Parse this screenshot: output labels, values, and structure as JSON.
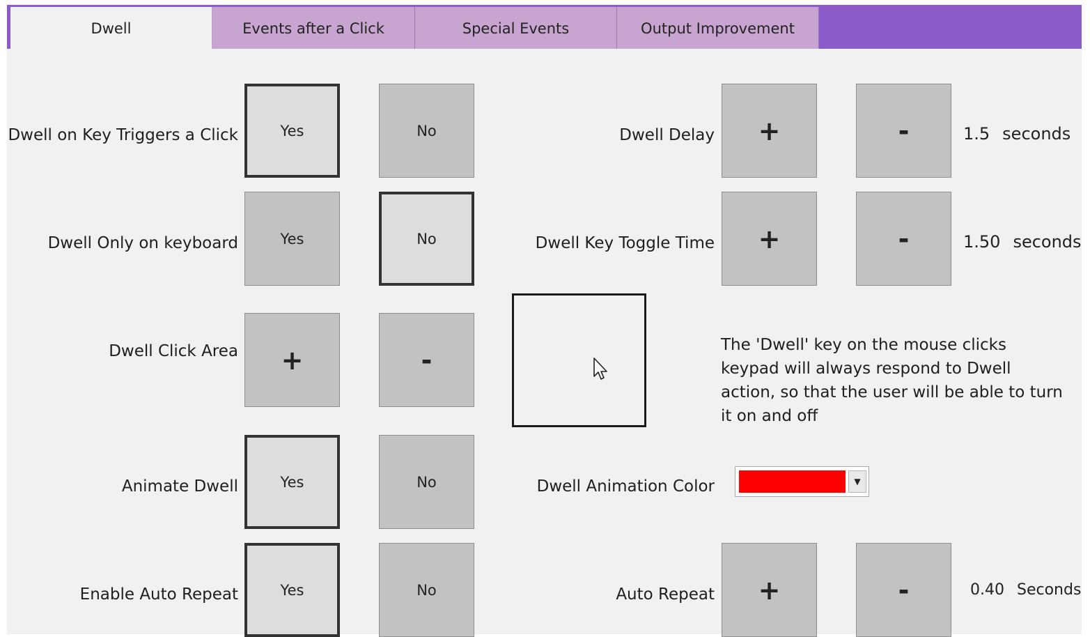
{
  "tabs": [
    {
      "label": "Dwell",
      "active": true
    },
    {
      "label": "Events after a Click",
      "active": false
    },
    {
      "label": "Special Events",
      "active": false
    },
    {
      "label": "Output Improvement",
      "active": false
    }
  ],
  "settings": {
    "dwell_on_key": {
      "label": "Dwell on Key Triggers a Click",
      "yes": "Yes",
      "no": "No",
      "selected": "Yes"
    },
    "dwell_only_keyboard": {
      "label": "Dwell Only on keyboard",
      "yes": "Yes",
      "no": "No",
      "selected": "No"
    },
    "dwell_click_area": {
      "label": "Dwell Click Area",
      "plus": "+",
      "minus": "-"
    },
    "animate_dwell": {
      "label": "Animate Dwell",
      "yes": "Yes",
      "no": "No",
      "selected": "Yes"
    },
    "enable_auto_repeat": {
      "label": "Enable Auto Repeat",
      "yes": "Yes",
      "no": "No",
      "selected": "Yes"
    },
    "dwell_delay": {
      "label": "Dwell Delay",
      "plus": "+",
      "minus": "-",
      "value": "1.5",
      "unit": "seconds"
    },
    "dwell_key_toggle": {
      "label": "Dwell Key Toggle Time",
      "plus": "+",
      "minus": "-",
      "value": "1.50",
      "unit": "seconds"
    },
    "dwell_animation_color": {
      "label": "Dwell Animation Color",
      "color": "#ff0000"
    },
    "auto_repeat": {
      "label": "Auto Repeat",
      "plus": "+",
      "minus": "-",
      "value": "0.40",
      "unit": "Seconds"
    }
  },
  "info_text": "The 'Dwell' key on the mouse clicks keypad will always respond to Dwell action, so that the user will be able to turn it on and off",
  "colors": {
    "tab_bar": "#8b5cc9",
    "tab": "#c7a5d0",
    "panel": "#f1f1f1",
    "button": "#c2c2c2",
    "button_selected": "#dedcdc"
  },
  "icons": {
    "cursor": "pointer-cursor-icon",
    "dropdown": "chevron-down-icon"
  }
}
